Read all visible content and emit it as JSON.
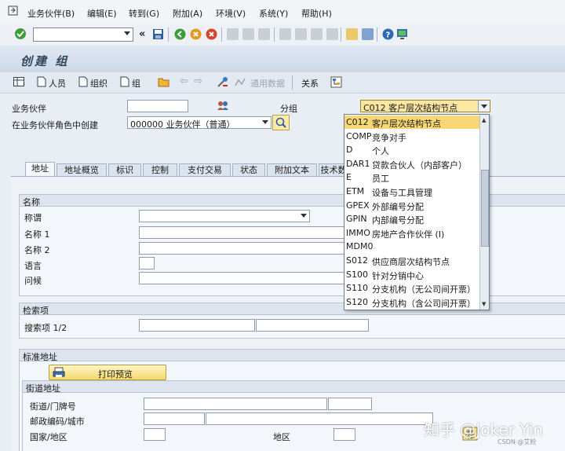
{
  "menubar": {
    "items": [
      "业务伙伴(B)",
      "编辑(E)",
      "转到(G)",
      "附加(A)",
      "环境(V)",
      "系统(Y)",
      "帮助(H)"
    ]
  },
  "toolbar": {
    "command_value": "",
    "icons": [
      "enter-check-icon",
      "save-icon",
      "back-icon",
      "exit-icon",
      "cancel-icon",
      "print-icon",
      "find-icon",
      "find-next-icon",
      "first-page-icon",
      "prev-page-icon",
      "next-page-icon",
      "last-page-icon",
      "create-session-icon",
      "shortcut-icon",
      "help-icon",
      "customize-layout-icon"
    ]
  },
  "title": "创建 组",
  "app_toolbar": {
    "person": "人员",
    "organization": "组织",
    "group": "组",
    "general_data": "通用数据",
    "relationships": "关系"
  },
  "form": {
    "bp_label": "业务伙伴",
    "bp_value": "",
    "grouping_label": "分组",
    "grouping_value": "C012 客户层次结构节点",
    "role_label": "在业务伙伴角色中创建",
    "role_value": "000000 业务伙伴（普通）"
  },
  "dropdown": {
    "items": [
      {
        "code": "C012",
        "name": "客户层次结构节点",
        "selected": true
      },
      {
        "code": "COMP",
        "name": "竞争对手"
      },
      {
        "code": "D",
        "name": "个人"
      },
      {
        "code": "DAR1",
        "name": "贷款合伙人（内部客户）"
      },
      {
        "code": "E",
        "name": "员工"
      },
      {
        "code": "ETM",
        "name": "设备与工具管理"
      },
      {
        "code": "GPEX",
        "name": "外部编号分配"
      },
      {
        "code": "GPIN",
        "name": "内部编号分配"
      },
      {
        "code": "IMMO",
        "name": "房地产合作伙伴 (I)"
      },
      {
        "code": "MDM0",
        "name": ""
      },
      {
        "code": "S012",
        "name": "供应商层次结构节点"
      },
      {
        "code": "S100",
        "name": "针对分销中心"
      },
      {
        "code": "S110",
        "name": "分支机构（无公司间开票）"
      },
      {
        "code": "S120",
        "name": "分支机构（含公司间开票）"
      }
    ]
  },
  "tabs": [
    "地址",
    "地址概览",
    "标识",
    "控制",
    "支付交易",
    "状态",
    "附加文本",
    "技术数"
  ],
  "name_group": {
    "header": "名称",
    "title_label": "称谓",
    "name1_label": "名称 1",
    "name2_label": "名称 2",
    "language_label": "语言",
    "greeting_label": "问候"
  },
  "search_group": {
    "header": "检索项",
    "search_label": "搜索项 1/2"
  },
  "address_group": {
    "header": "标准地址",
    "print_preview": "打印预览",
    "street_header": "街道地址",
    "street_label": "街道/门牌号",
    "postal_label": "邮政编码/城市",
    "country_label": "国家/地区",
    "region_label": "地区"
  },
  "watermark": {
    "main": "知乎 @Joker Yin",
    "sub": "CSDN @艾睑"
  }
}
